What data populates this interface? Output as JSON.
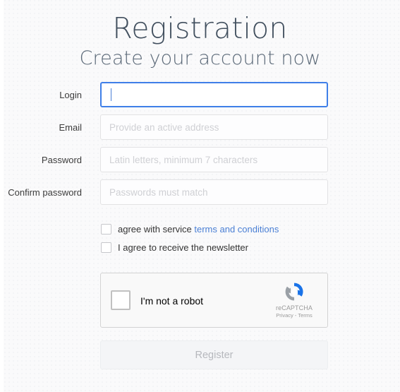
{
  "header": {
    "title": "Registration",
    "subtitle": "Create your account now"
  },
  "form": {
    "fields": [
      {
        "label": "Login",
        "placeholder": "",
        "value": "",
        "focused": true,
        "type": "text"
      },
      {
        "label": "Email",
        "placeholder": "Provide an active address",
        "value": "",
        "focused": false,
        "type": "text"
      },
      {
        "label": "Password",
        "placeholder": "Latin letters, minimum 7 characters",
        "value": "",
        "focused": false,
        "type": "password"
      },
      {
        "label": "Confirm password",
        "placeholder": "Passwords must match",
        "value": "",
        "focused": false,
        "type": "password"
      }
    ],
    "checkboxes": [
      {
        "text_before": "agree with service ",
        "link_text": "terms and conditions",
        "text_after": "",
        "checked": false
      },
      {
        "text_before": "I agree to receive the newsletter",
        "link_text": "",
        "text_after": "",
        "checked": false
      }
    ],
    "recaptcha": {
      "label": "I'm not a robot",
      "brand_name": "reCAPTCHA",
      "legal": "Privacy - Terms",
      "checked": false,
      "logo_icon": "recaptcha-circular-arrows-icon",
      "logo_blue": "#1a73e8",
      "logo_gray": "#9aa0a6"
    },
    "submit": {
      "label": "Register",
      "enabled": false
    }
  },
  "colors": {
    "link": "#4a7fd4",
    "focus_border": "#3f7fe8",
    "page_background": "#fafafb",
    "heading": "#414f5e"
  }
}
